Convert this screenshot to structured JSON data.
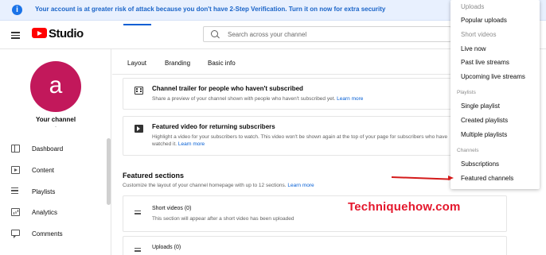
{
  "alert": {
    "text": "Your account is at greater risk of attack because you don't have 2-Step Verification. Turn it on now for extra security",
    "icon": "info-icon"
  },
  "header": {
    "logo_text": "Studio",
    "search_placeholder": "Search across your channel"
  },
  "sidebar": {
    "avatar_letter": "a",
    "channel_label": "Your channel",
    "channel_sub": "-",
    "items": [
      {
        "label": "Dashboard",
        "icon": "dashboard-icon"
      },
      {
        "label": "Content",
        "icon": "content-icon"
      },
      {
        "label": "Playlists",
        "icon": "playlists-icon"
      },
      {
        "label": "Analytics",
        "icon": "analytics-icon"
      },
      {
        "label": "Comments",
        "icon": "comments-icon"
      }
    ]
  },
  "tabs": [
    {
      "label": "Layout",
      "active": true
    },
    {
      "label": "Branding",
      "active": false
    },
    {
      "label": "Basic info",
      "active": false
    }
  ],
  "cards": [
    {
      "title": "Channel trailer for people who haven't subscribed",
      "desc": "Share a preview of your channel shown with people who haven't subscribed yet.",
      "link": "Learn more"
    },
    {
      "title": "Featured video for returning subscribers",
      "desc": "Highlight a video for your subscribers to watch. This video won't be shown again at the top of your page for subscribers who have watched it.",
      "link": "Learn more"
    }
  ],
  "featured": {
    "title": "Featured sections",
    "desc": "Customize the layout of your channel homepage with up to 12 sections.",
    "link": "Learn more",
    "rows": [
      {
        "title": "Short videos (0)",
        "desc": "This section will appear after a short video has been uploaded"
      },
      {
        "title": "Uploads (0)",
        "desc": ""
      }
    ]
  },
  "dropdown": {
    "items_top": [
      {
        "label": "Uploads",
        "muted": true
      },
      {
        "label": "Popular uploads",
        "muted": false
      },
      {
        "label": "Short videos",
        "muted": true
      },
      {
        "label": "Live now",
        "muted": false
      },
      {
        "label": "Past live streams",
        "muted": false
      },
      {
        "label": "Upcoming live streams",
        "muted": false
      }
    ],
    "group_playlists": "Playlists",
    "items_playlists": [
      "Single playlist",
      "Created playlists",
      "Multiple playlists"
    ],
    "group_channels": "Channels",
    "items_channels": [
      "Subscriptions",
      "Featured channels"
    ]
  },
  "watermark": "Techniquehow.com",
  "colors": {
    "accent": "#065fd4",
    "alert_bg": "#e8f0fe",
    "avatar_bg": "#c2185b",
    "annotation": "#d41b1b"
  }
}
